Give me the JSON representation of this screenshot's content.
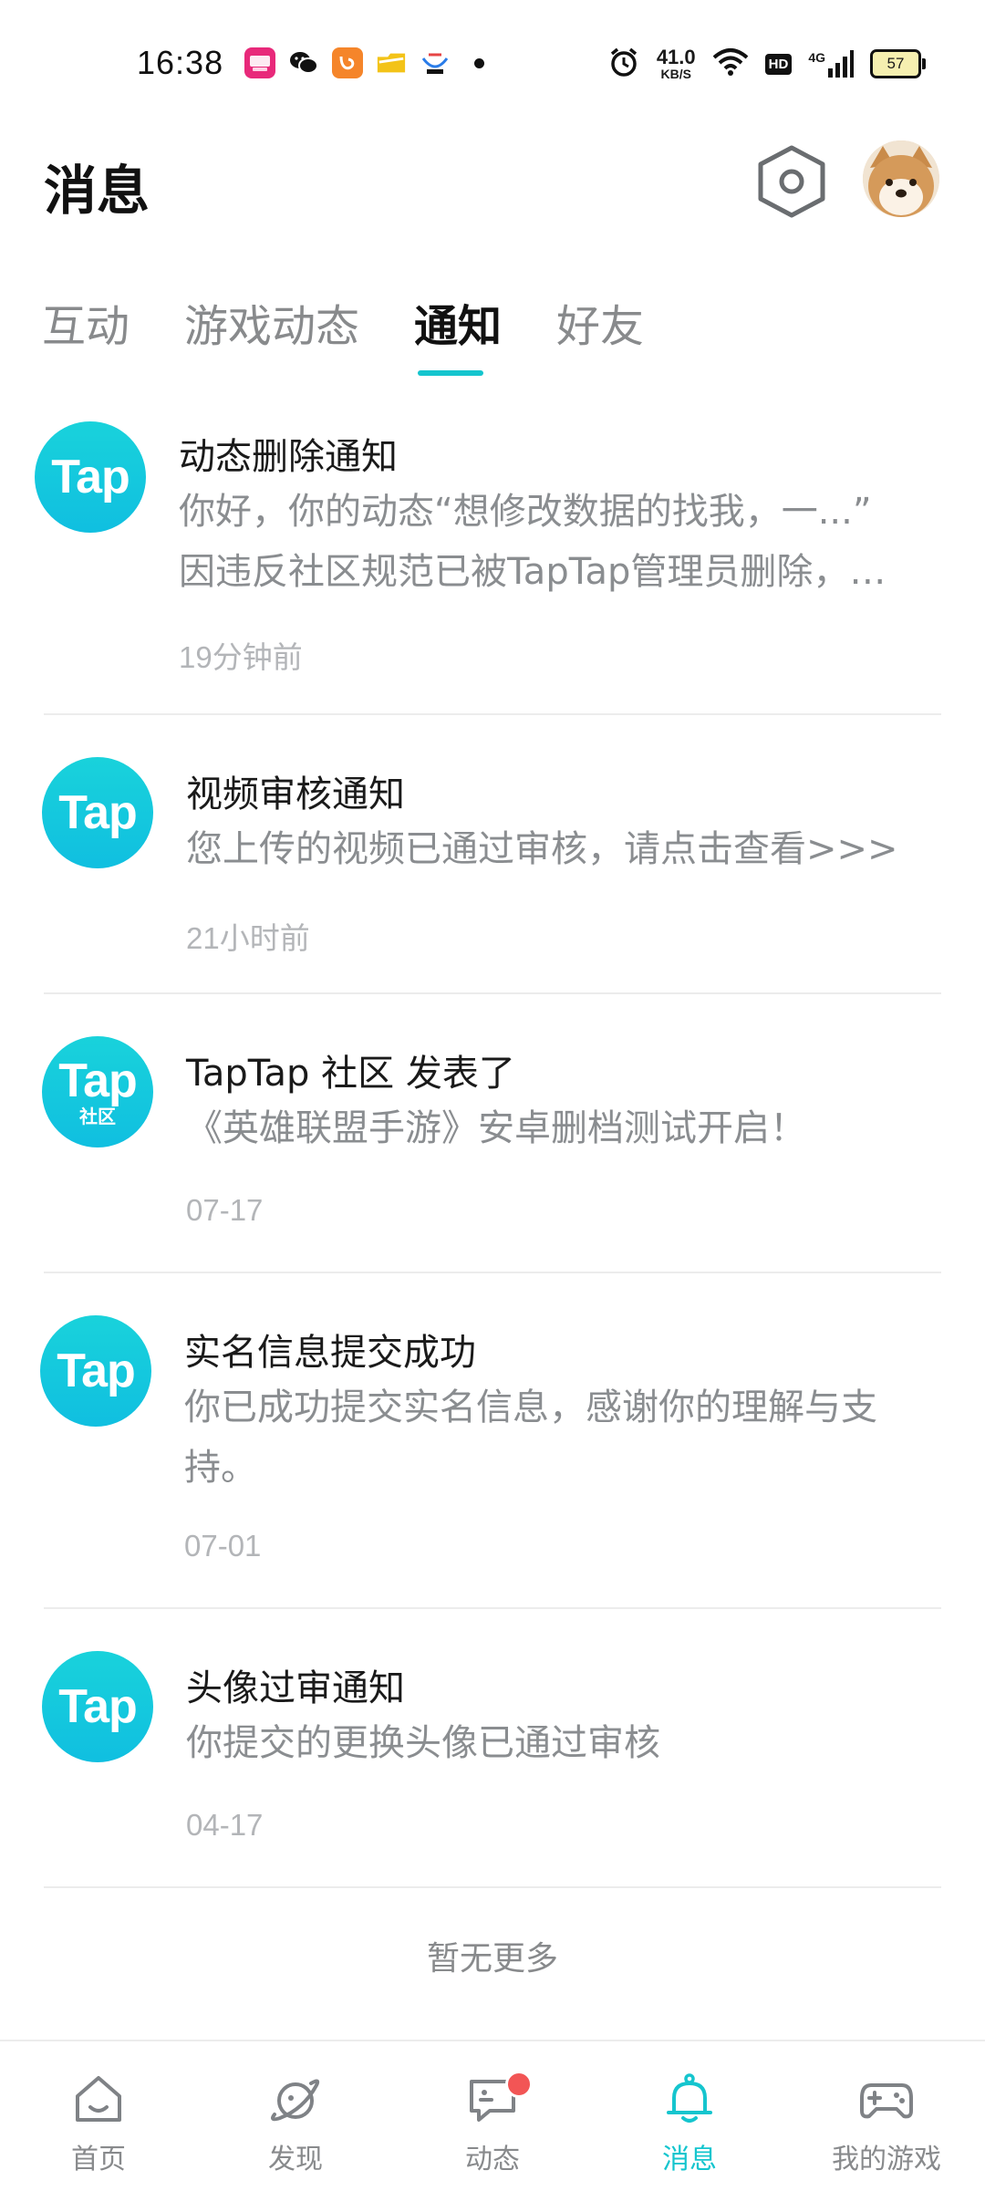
{
  "status_bar": {
    "time": "16:38",
    "network_speed_value": "41.0",
    "network_speed_unit": "KB/S",
    "hd_label": "HD",
    "signal_label": "4G",
    "battery_level": "57",
    "app_icons": [
      "huobao-icon",
      "wechat-icon",
      "uc-browser-icon",
      "folder-app-icon",
      "game-app-icon"
    ]
  },
  "header": {
    "title": "消息"
  },
  "tabs": [
    {
      "label": "互动",
      "active": false
    },
    {
      "label": "游戏动态",
      "active": false
    },
    {
      "label": "通知",
      "active": true
    },
    {
      "label": "好友",
      "active": false
    }
  ],
  "notifications": [
    {
      "logo_text": "Tap",
      "logo_sub": "",
      "title": "动态删除通知",
      "body_line1": "你好，你的动态“想修改数据的找我，一...”",
      "body_line2": "因违反社区规范已被TapTap管理员删除，…",
      "time": "19分钟前"
    },
    {
      "logo_text": "Tap",
      "logo_sub": "",
      "title": "视频审核通知",
      "body_line1": "您上传的视频已通过审核，请点击查看>>>",
      "body_line2": "",
      "time": "21小时前"
    },
    {
      "logo_text": "Tap",
      "logo_sub": "社区",
      "title": "TapTap 社区 发表了",
      "body_line1": "《英雄联盟手游》安卓删档测试开启！",
      "body_line2": "",
      "time": "07-17"
    },
    {
      "logo_text": "Tap",
      "logo_sub": "",
      "title": "实名信息提交成功",
      "body_line1": "你已成功提交实名信息，感谢你的理解与支",
      "body_line2": "持。",
      "time": "07-01"
    },
    {
      "logo_text": "Tap",
      "logo_sub": "",
      "title": "头像过审通知",
      "body_line1": "你提交的更换头像已通过审核",
      "body_line2": "",
      "time": "04-17"
    }
  ],
  "footer_text": "暂无更多",
  "bottom_nav": [
    {
      "label": "首页",
      "icon": "home-icon",
      "active": false
    },
    {
      "label": "发现",
      "icon": "discover-planet-icon",
      "active": false
    },
    {
      "label": "动态",
      "icon": "feed-chat-icon",
      "active": false,
      "badge": true
    },
    {
      "label": "消息",
      "icon": "bell-icon",
      "active": true
    },
    {
      "label": "我的游戏",
      "icon": "gamepad-icon",
      "active": false
    }
  ],
  "colors": {
    "accent": "#15c5ce",
    "badge": "#f25555",
    "muted_text": "#8a8d90"
  }
}
